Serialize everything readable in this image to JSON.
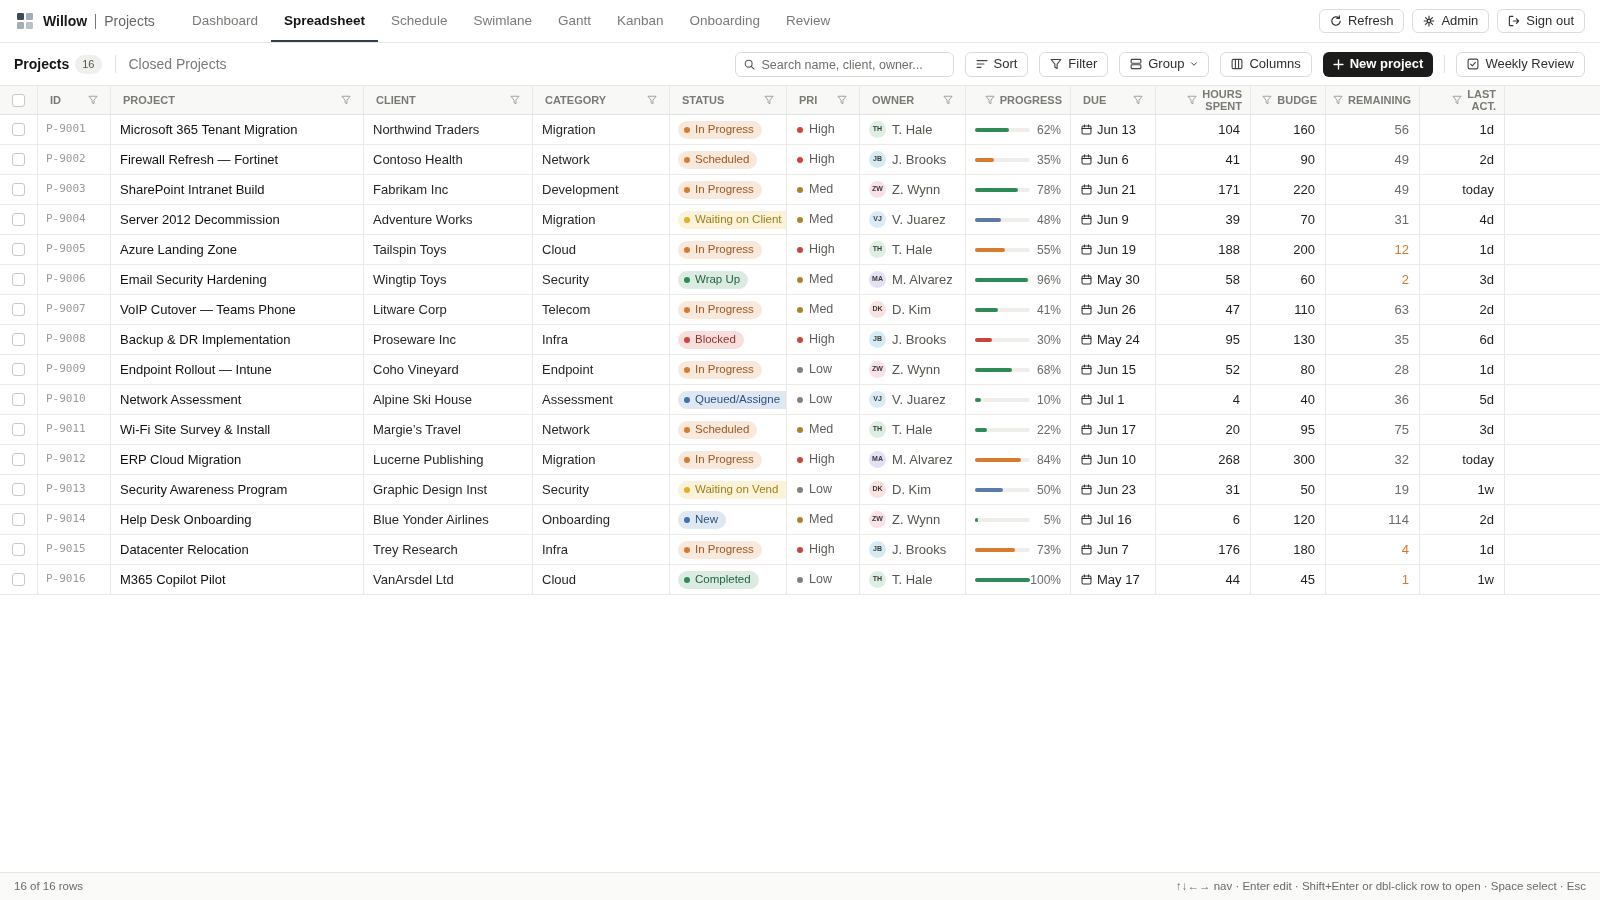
{
  "app": {
    "name": "Willow",
    "section": "Projects"
  },
  "nav_tabs": [
    {
      "label": "Dashboard",
      "selected": false
    },
    {
      "label": "Spreadsheet",
      "selected": true
    },
    {
      "label": "Schedule",
      "selected": false
    },
    {
      "label": "Swimlane",
      "selected": false
    },
    {
      "label": "Gantt",
      "selected": false
    },
    {
      "label": "Kanban",
      "selected": false
    },
    {
      "label": "Onboarding",
      "selected": false
    },
    {
      "label": "Review",
      "selected": false
    }
  ],
  "actions": {
    "refresh": "Refresh",
    "admin": "Admin",
    "sign_out": "Sign out"
  },
  "view_tabs": [
    {
      "label": "Projects",
      "count": "16",
      "selected": true
    },
    {
      "label": "Closed Projects",
      "selected": false
    }
  ],
  "search": {
    "placeholder": "Search name, client, owner..."
  },
  "toolbar": {
    "sort": "Sort",
    "filter": "Filter",
    "group": "Group",
    "columns": "Columns",
    "new_project": "New project",
    "weekly_review": "Weekly Review"
  },
  "table": {
    "header_checked": false,
    "columns": [
      {
        "label": "ID",
        "kind": "text"
      },
      {
        "label": "PROJECT",
        "kind": "text"
      },
      {
        "label": "CLIENT",
        "kind": "text"
      },
      {
        "label": "CATEGORY",
        "kind": "text"
      },
      {
        "label": "STATUS",
        "kind": "text"
      },
      {
        "label": "PRI",
        "kind": "text"
      },
      {
        "label": "OWNER",
        "kind": "text"
      },
      {
        "label": "PROGRESS",
        "kind": "numeric"
      },
      {
        "label": "DUE",
        "kind": "text"
      },
      {
        "label": "HOURS SPENT",
        "kind": "numeric"
      },
      {
        "label": "BUDGE",
        "kind": "numeric"
      },
      {
        "label": "REMAINING",
        "kind": "numeric"
      },
      {
        "label": "LAST ACT.",
        "kind": "numeric"
      }
    ],
    "rows": [
      {
        "checked": false,
        "id": "P-9001",
        "project": "Microsoft 365 Tenant Migration",
        "client": "Northwind Traders",
        "category": "Migration",
        "status": {
          "label": "In Progress",
          "color": "#d97b2f",
          "clipped": false
        },
        "priority": {
          "label": "High",
          "color": "#d0453a"
        },
        "owner": {
          "initials": "TH",
          "name": "T. Hale",
          "color": "#dcefe2"
        },
        "progress": {
          "level": 0.62,
          "reading": "62%",
          "color": "#2e8b57"
        },
        "due": "Jun 13",
        "hours_spent": "104",
        "budget": "160",
        "remaining": {
          "value": "56",
          "low": false
        },
        "last_activity": "1d"
      },
      {
        "checked": false,
        "id": "P-9002",
        "project": "Firewall Refresh — Fortinet",
        "client": "Contoso Health",
        "category": "Network",
        "status": {
          "label": "Scheduled",
          "color": "#d97b2f",
          "clipped": false
        },
        "priority": {
          "label": "High",
          "color": "#d0453a"
        },
        "owner": {
          "initials": "JB",
          "name": "J. Brooks",
          "color": "#d4ecf1"
        },
        "progress": {
          "level": 0.35,
          "reading": "35%",
          "color": "#d97b2f"
        },
        "due": "Jun 6",
        "hours_spent": "41",
        "budget": "90",
        "remaining": {
          "value": "49",
          "low": false
        },
        "last_activity": "2d"
      },
      {
        "checked": false,
        "id": "P-9003",
        "project": "SharePoint Intranet Build",
        "client": "Fabrikam Inc",
        "category": "Development",
        "status": {
          "label": "In Progress",
          "color": "#d97b2f",
          "clipped": false
        },
        "priority": {
          "label": "Med",
          "color": "#b0822f"
        },
        "owner": {
          "initials": "ZW",
          "name": "Z. Wynn",
          "color": "#f9e1e8"
        },
        "progress": {
          "level": 0.78,
          "reading": "78%",
          "color": "#2e8b57"
        },
        "due": "Jun 21",
        "hours_spent": "171",
        "budget": "220",
        "remaining": {
          "value": "49",
          "low": false
        },
        "last_activity": "today"
      },
      {
        "checked": false,
        "id": "P-9004",
        "project": "Server 2012 Decommission",
        "client": "Adventure Works",
        "category": "Migration",
        "status": {
          "label": "Waiting on Client",
          "color": "#e0b020",
          "clipped": true
        },
        "priority": {
          "label": "Med",
          "color": "#b0822f"
        },
        "owner": {
          "initials": "VJ",
          "name": "V. Juarez",
          "color": "#d8ebf6"
        },
        "progress": {
          "level": 0.48,
          "reading": "48%",
          "color": "#5b7aa5"
        },
        "due": "Jun 9",
        "hours_spent": "39",
        "budget": "70",
        "remaining": {
          "value": "31",
          "low": false
        },
        "last_activity": "4d"
      },
      {
        "checked": false,
        "id": "P-9005",
        "project": "Azure Landing Zone",
        "client": "Tailspin Toys",
        "category": "Cloud",
        "status": {
          "label": "In Progress",
          "color": "#d97b2f",
          "clipped": false
        },
        "priority": {
          "label": "High",
          "color": "#d0453a"
        },
        "owner": {
          "initials": "TH",
          "name": "T. Hale",
          "color": "#dcefe2"
        },
        "progress": {
          "level": 0.55,
          "reading": "55%",
          "color": "#d97b2f"
        },
        "due": "Jun 19",
        "hours_spent": "188",
        "budget": "200",
        "remaining": {
          "value": "12",
          "low": true
        },
        "last_activity": "1d"
      },
      {
        "checked": false,
        "id": "P-9006",
        "project": "Email Security Hardening",
        "client": "Wingtip Toys",
        "category": "Security",
        "status": {
          "label": "Wrap Up",
          "color": "#2e8b57",
          "clipped": false
        },
        "priority": {
          "label": "Med",
          "color": "#b0822f"
        },
        "owner": {
          "initials": "MA",
          "name": "M. Alvarez",
          "color": "#e5e0f6"
        },
        "progress": {
          "level": 0.96,
          "reading": "96%",
          "color": "#2e8b57"
        },
        "due": "May 30",
        "hours_spent": "58",
        "budget": "60",
        "remaining": {
          "value": "2",
          "low": true
        },
        "last_activity": "3d"
      },
      {
        "checked": false,
        "id": "P-9007",
        "project": "VoIP Cutover — Teams Phone",
        "client": "Litware Corp",
        "category": "Telecom",
        "status": {
          "label": "In Progress",
          "color": "#d97b2f",
          "clipped": false
        },
        "priority": {
          "label": "Med",
          "color": "#b0822f"
        },
        "owner": {
          "initials": "DK",
          "name": "D. Kim",
          "color": "#f9e2e0"
        },
        "progress": {
          "level": 0.41,
          "reading": "41%",
          "color": "#2e8b57"
        },
        "due": "Jun 26",
        "hours_spent": "47",
        "budget": "110",
        "remaining": {
          "value": "63",
          "low": false
        },
        "last_activity": "2d"
      },
      {
        "checked": false,
        "id": "P-9008",
        "project": "Backup & DR Implementation",
        "client": "Proseware Inc",
        "category": "Infra",
        "status": {
          "label": "Blocked",
          "color": "#d0453a",
          "clipped": false
        },
        "priority": {
          "label": "High",
          "color": "#d0453a"
        },
        "owner": {
          "initials": "JB",
          "name": "J. Brooks",
          "color": "#d4ecf1"
        },
        "progress": {
          "level": 0.3,
          "reading": "30%",
          "color": "#c9433a"
        },
        "due": "May 24",
        "hours_spent": "95",
        "budget": "130",
        "remaining": {
          "value": "35",
          "low": false
        },
        "last_activity": "6d"
      },
      {
        "checked": false,
        "id": "P-9009",
        "project": "Endpoint Rollout — Intune",
        "client": "Coho Vineyard",
        "category": "Endpoint",
        "status": {
          "label": "In Progress",
          "color": "#d97b2f",
          "clipped": false
        },
        "priority": {
          "label": "Low",
          "color": "#808080"
        },
        "owner": {
          "initials": "ZW",
          "name": "Z. Wynn",
          "color": "#f9e1e8"
        },
        "progress": {
          "level": 0.68,
          "reading": "68%",
          "color": "#2e8b57"
        },
        "due": "Jun 15",
        "hours_spent": "52",
        "budget": "80",
        "remaining": {
          "value": "28",
          "low": false
        },
        "last_activity": "1d"
      },
      {
        "checked": false,
        "id": "P-9010",
        "project": "Network Assessment",
        "client": "Alpine Ski House",
        "category": "Assessment",
        "status": {
          "label": "Queued/Assigne",
          "color": "#3d72b4",
          "clipped": true
        },
        "priority": {
          "label": "Low",
          "color": "#808080"
        },
        "owner": {
          "initials": "VJ",
          "name": "V. Juarez",
          "color": "#d8ebf6"
        },
        "progress": {
          "level": 0.1,
          "reading": "10%",
          "color": "#2e8b57"
        },
        "due": "Jul 1",
        "hours_spent": "4",
        "budget": "40",
        "remaining": {
          "value": "36",
          "low": false
        },
        "last_activity": "5d"
      },
      {
        "checked": false,
        "id": "P-9011",
        "project": "Wi-Fi Site Survey & Install",
        "client": "Margie’s Travel",
        "category": "Network",
        "status": {
          "label": "Scheduled",
          "color": "#d97b2f",
          "clipped": false
        },
        "priority": {
          "label": "Med",
          "color": "#b0822f"
        },
        "owner": {
          "initials": "TH",
          "name": "T. Hale",
          "color": "#dcefe2"
        },
        "progress": {
          "level": 0.22,
          "reading": "22%",
          "color": "#2e8b57"
        },
        "due": "Jun 17",
        "hours_spent": "20",
        "budget": "95",
        "remaining": {
          "value": "75",
          "low": false
        },
        "last_activity": "3d"
      },
      {
        "checked": false,
        "id": "P-9012",
        "project": "ERP Cloud Migration",
        "client": "Lucerne Publishing",
        "category": "Migration",
        "status": {
          "label": "In Progress",
          "color": "#d97b2f",
          "clipped": false
        },
        "priority": {
          "label": "High",
          "color": "#d0453a"
        },
        "owner": {
          "initials": "MA",
          "name": "M. Alvarez",
          "color": "#e5e0f6"
        },
        "progress": {
          "level": 0.84,
          "reading": "84%",
          "color": "#d97b2f"
        },
        "due": "Jun 10",
        "hours_spent": "268",
        "budget": "300",
        "remaining": {
          "value": "32",
          "low": false
        },
        "last_activity": "today"
      },
      {
        "checked": false,
        "id": "P-9013",
        "project": "Security Awareness Program",
        "client": "Graphic Design Inst",
        "category": "Security",
        "status": {
          "label": "Waiting on Vend",
          "color": "#e0b020",
          "clipped": true
        },
        "priority": {
          "label": "Low",
          "color": "#808080"
        },
        "owner": {
          "initials": "DK",
          "name": "D. Kim",
          "color": "#f9e2e0"
        },
        "progress": {
          "level": 0.5,
          "reading": "50%",
          "color": "#5b7aa5"
        },
        "due": "Jun 23",
        "hours_spent": "31",
        "budget": "50",
        "remaining": {
          "value": "19",
          "low": false
        },
        "last_activity": "1w"
      },
      {
        "checked": false,
        "id": "P-9014",
        "project": "Help Desk Onboarding",
        "client": "Blue Yonder Airlines",
        "category": "Onboarding",
        "status": {
          "label": "New",
          "color": "#3d72b4",
          "clipped": false
        },
        "priority": {
          "label": "Med",
          "color": "#b0822f"
        },
        "owner": {
          "initials": "ZW",
          "name": "Z. Wynn",
          "color": "#f9e1e8"
        },
        "progress": {
          "level": 0.05,
          "reading": "5%",
          "color": "#2e8b57"
        },
        "due": "Jul 16",
        "hours_spent": "6",
        "budget": "120",
        "remaining": {
          "value": "114",
          "low": false
        },
        "last_activity": "2d"
      },
      {
        "checked": false,
        "id": "P-9015",
        "project": "Datacenter Relocation",
        "client": "Trey Research",
        "category": "Infra",
        "status": {
          "label": "In Progress",
          "color": "#d97b2f",
          "clipped": false
        },
        "priority": {
          "label": "High",
          "color": "#d0453a"
        },
        "owner": {
          "initials": "JB",
          "name": "J. Brooks",
          "color": "#d4ecf1"
        },
        "progress": {
          "level": 0.73,
          "reading": "73%",
          "color": "#d97b2f"
        },
        "due": "Jun 7",
        "hours_spent": "176",
        "budget": "180",
        "remaining": {
          "value": "4",
          "low": true
        },
        "last_activity": "1d"
      },
      {
        "checked": false,
        "id": "P-9016",
        "project": "M365 Copilot Pilot",
        "client": "VanArsdel Ltd",
        "category": "Cloud",
        "status": {
          "label": "Completed",
          "color": "#2e8b57",
          "clipped": false
        },
        "priority": {
          "label": "Low",
          "color": "#808080"
        },
        "owner": {
          "initials": "TH",
          "name": "T. Hale",
          "color": "#dcefe2"
        },
        "progress": {
          "level": 1.0,
          "reading": "100%",
          "color": "#2e8b57"
        },
        "due": "May 17",
        "hours_spent": "44",
        "budget": "45",
        "remaining": {
          "value": "1",
          "low": true
        },
        "last_activity": "1w"
      }
    ]
  },
  "status_bar": {
    "row_count": "16 of 16 rows",
    "hints": "↑↓←→ nav · Enter edit · Shift+Enter or dbl-click row to open · Space select · Esc"
  }
}
